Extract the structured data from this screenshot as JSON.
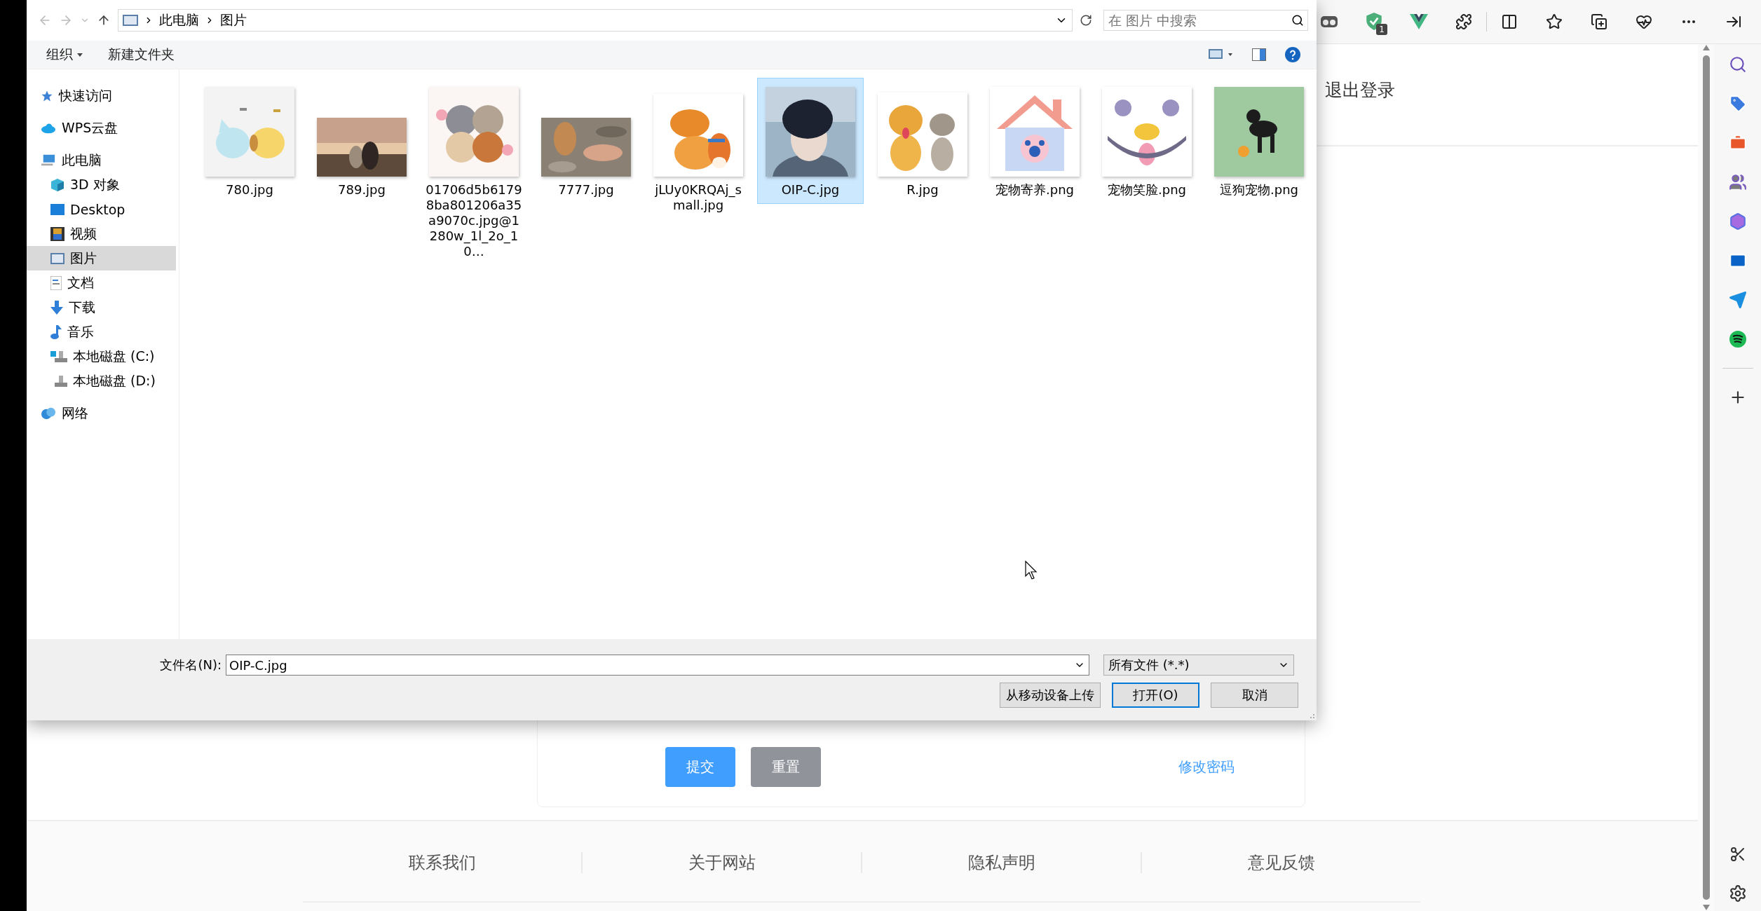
{
  "file_dialog": {
    "address": {
      "path": [
        "此电脑",
        "图片"
      ],
      "search_placeholder": "在 图片 中搜索"
    },
    "toolbar": {
      "organize": "组织",
      "new_folder": "新建文件夹"
    },
    "nav": [
      {
        "label": "快速访问",
        "selected": false
      },
      {
        "label": "WPS云盘",
        "selected": false
      },
      {
        "label": "此电脑",
        "selected": false,
        "children": [
          {
            "label": "3D 对象",
            "selected": false
          },
          {
            "label": "Desktop",
            "selected": false
          },
          {
            "label": "视频",
            "selected": false
          },
          {
            "label": "图片",
            "selected": true
          },
          {
            "label": "文档",
            "selected": false
          },
          {
            "label": "下载",
            "selected": false
          },
          {
            "label": "音乐",
            "selected": false
          },
          {
            "label": "本地磁盘 (C:)",
            "selected": false
          },
          {
            "label": "本地磁盘 (D:)",
            "selected": false
          }
        ]
      },
      {
        "label": "网络",
        "selected": false
      }
    ],
    "files": [
      {
        "name": "780.jpg",
        "selected": false
      },
      {
        "name": "789.jpg",
        "selected": false
      },
      {
        "name": "01706d5b61798ba801206a35a9070c.jpg@1280w_1l_2o_10…",
        "selected": false
      },
      {
        "name": "7777.jpg",
        "selected": false
      },
      {
        "name": "jLUy0KRQAj_small.jpg",
        "selected": false
      },
      {
        "name": "OIP-C.jpg",
        "selected": true
      },
      {
        "name": "R.jpg",
        "selected": false
      },
      {
        "name": "宠物寄养.png",
        "selected": false
      },
      {
        "name": "宠物笑脸.png",
        "selected": false
      },
      {
        "name": "逗狗宠物.png",
        "selected": false
      }
    ],
    "file_name": {
      "label": "文件名(N):",
      "value": "OIP-C.jpg"
    },
    "file_type": "所有文件 (*.*)",
    "buttons": [
      {
        "label": "从移动设备上传",
        "default": false
      },
      {
        "label": "打开(O)",
        "default": true
      },
      {
        "label": "取消",
        "default": false
      }
    ]
  },
  "browser": {
    "extension_badge": "1"
  },
  "page": {
    "logout": "退出登录",
    "form_buttons": [
      {
        "label": "提交",
        "kind": "primary"
      },
      {
        "label": "重置",
        "kind": "secondary"
      }
    ],
    "change_password": "修改密码",
    "footer_links": [
      "联系我们",
      "关于网站",
      "隐私声明",
      "意见反馈"
    ]
  }
}
